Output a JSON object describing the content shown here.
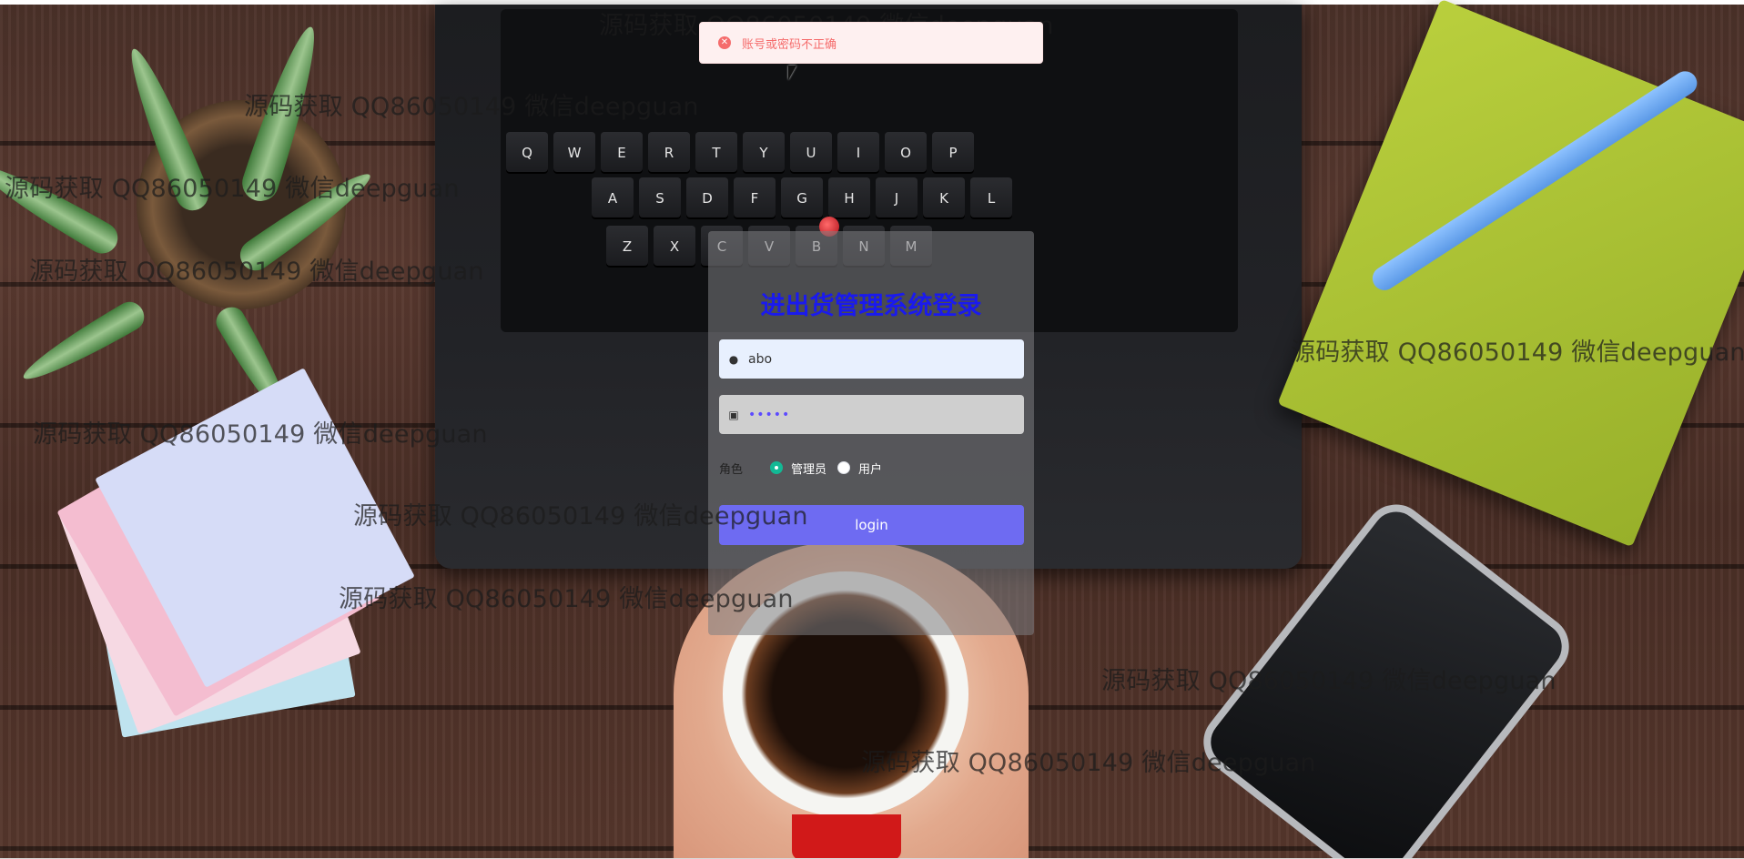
{
  "toast": {
    "icon": "error-circle-icon",
    "message": "账号或密码不正确",
    "color": "#f56c6c"
  },
  "login": {
    "title": "进出货管理系统登录",
    "username": {
      "icon": "user-icon",
      "value": "abo"
    },
    "password": {
      "icon": "lock-icon",
      "masked_value": "•••••"
    },
    "role": {
      "label": "角色",
      "options": [
        {
          "label": "管理员",
          "checked": true
        },
        {
          "label": "用户",
          "checked": false
        }
      ]
    },
    "submit_label": "login"
  },
  "watermark": {
    "text": "源码获取 QQ86050149 微信deepguan"
  },
  "colors": {
    "title": "#1a1aee",
    "button": "#6e6bf2",
    "radio_checked": "#13b995"
  }
}
